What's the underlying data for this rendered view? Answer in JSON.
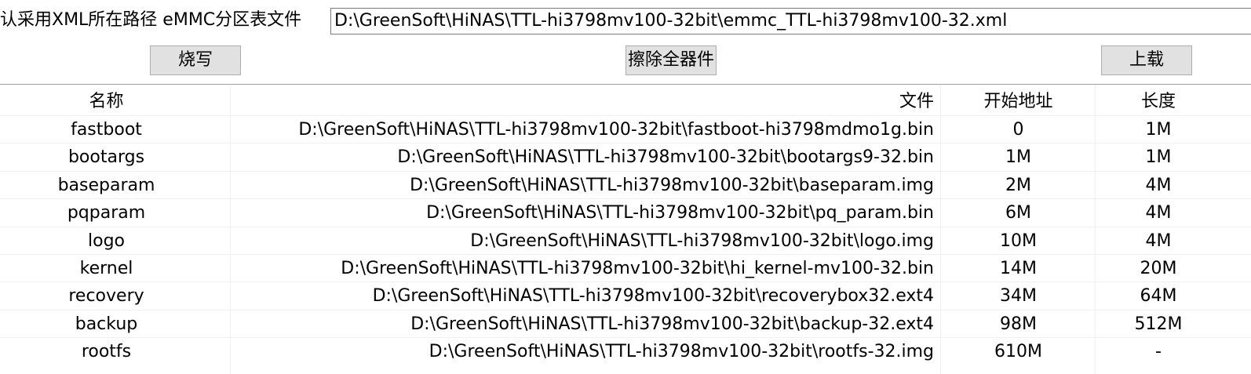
{
  "path_label": "认采用XML所在路径 eMMC分区表文件",
  "path_value": "D:\\GreenSoft\\HiNAS\\TTL-hi3798mv100-32bit\\emmc_TTL-hi3798mv100-32.xml",
  "buttons": {
    "write": "烧写",
    "erase": "擦除全器件",
    "upload": "上载"
  },
  "table": {
    "headers": {
      "name": "名称",
      "file": "文件",
      "start": "开始地址",
      "length": "长度"
    },
    "rows": [
      {
        "name": "fastboot",
        "file": "D:\\GreenSoft\\HiNAS\\TTL-hi3798mv100-32bit\\fastboot-hi3798mdmo1g.bin",
        "start": "0",
        "length": "1M"
      },
      {
        "name": "bootargs",
        "file": "D:\\GreenSoft\\HiNAS\\TTL-hi3798mv100-32bit\\bootargs9-32.bin",
        "start": "1M",
        "length": "1M"
      },
      {
        "name": "baseparam",
        "file": "D:\\GreenSoft\\HiNAS\\TTL-hi3798mv100-32bit\\baseparam.img",
        "start": "2M",
        "length": "4M"
      },
      {
        "name": "pqparam",
        "file": "D:\\GreenSoft\\HiNAS\\TTL-hi3798mv100-32bit\\pq_param.bin",
        "start": "6M",
        "length": "4M"
      },
      {
        "name": "logo",
        "file": "D:\\GreenSoft\\HiNAS\\TTL-hi3798mv100-32bit\\logo.img",
        "start": "10M",
        "length": "4M"
      },
      {
        "name": "kernel",
        "file": "D:\\GreenSoft\\HiNAS\\TTL-hi3798mv100-32bit\\hi_kernel-mv100-32.bin",
        "start": "14M",
        "length": "20M"
      },
      {
        "name": "recovery",
        "file": "D:\\GreenSoft\\HiNAS\\TTL-hi3798mv100-32bit\\recoverybox32.ext4",
        "start": "34M",
        "length": "64M"
      },
      {
        "name": "backup",
        "file": "D:\\GreenSoft\\HiNAS\\TTL-hi3798mv100-32bit\\backup-32.ext4",
        "start": "98M",
        "length": "512M"
      },
      {
        "name": "rootfs",
        "file": "D:\\GreenSoft\\HiNAS\\TTL-hi3798mv100-32bit\\rootfs-32.img",
        "start": "610M",
        "length": "-"
      }
    ]
  }
}
